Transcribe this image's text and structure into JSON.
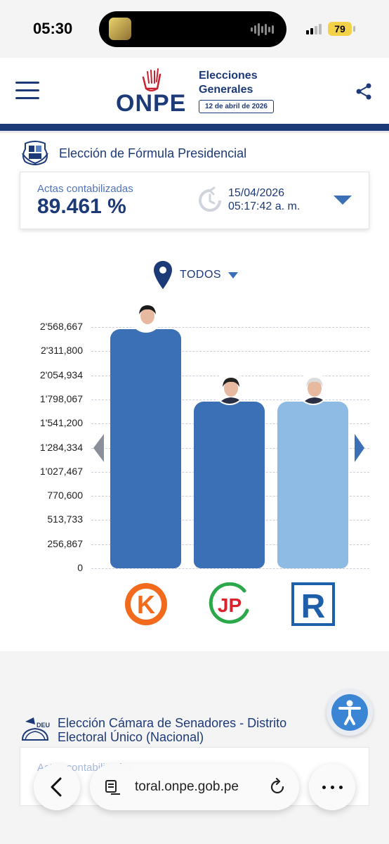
{
  "status_bar": {
    "time": "05:30",
    "battery": "79"
  },
  "header": {
    "logo_text": "ONPE",
    "event_title": "Elecciones Generales",
    "event_date": "12 de abril de 2026",
    "icons": {
      "menu": "hamburger-menu-icon",
      "share": "share-icon"
    }
  },
  "section1": {
    "title": "Elección de Fórmula Presidencial",
    "actas_label": "Actas contabilizadas",
    "actas_value": "89.461 %",
    "update_date": "15/04/2026",
    "update_time": "05:17:42 a. m."
  },
  "filter": {
    "location": "TODOS"
  },
  "chart_data": {
    "type": "bar",
    "categories": [
      "K",
      "JP",
      "R"
    ],
    "values": [
      2568667,
      1798067,
      1798067
    ],
    "y_ticks": [
      "2'568,667",
      "2'311,800",
      "2'054,934",
      "1'798,067",
      "1'541,200",
      "1'284,334",
      "1'027,467",
      "770,600",
      "513,733",
      "256,867",
      "0"
    ],
    "ylim": [
      0,
      2568667
    ],
    "bar_colors": [
      "#3b6fb6",
      "#3b6fb6",
      "#8dbbe3"
    ],
    "party_logos": [
      "K",
      "JP",
      "R"
    ],
    "grid": true
  },
  "section2": {
    "title": "Elección Cámara de Senadores - Distrito Electoral Único (Nacional)",
    "actas_label": "Actas contabilizadas",
    "badge": "DEU"
  },
  "browser": {
    "url": "toral.onpe.gob.pe"
  },
  "colors": {
    "brand": "#1d3a78",
    "accent": "#3b6fb6",
    "light_bar": "#8dbbe3"
  }
}
